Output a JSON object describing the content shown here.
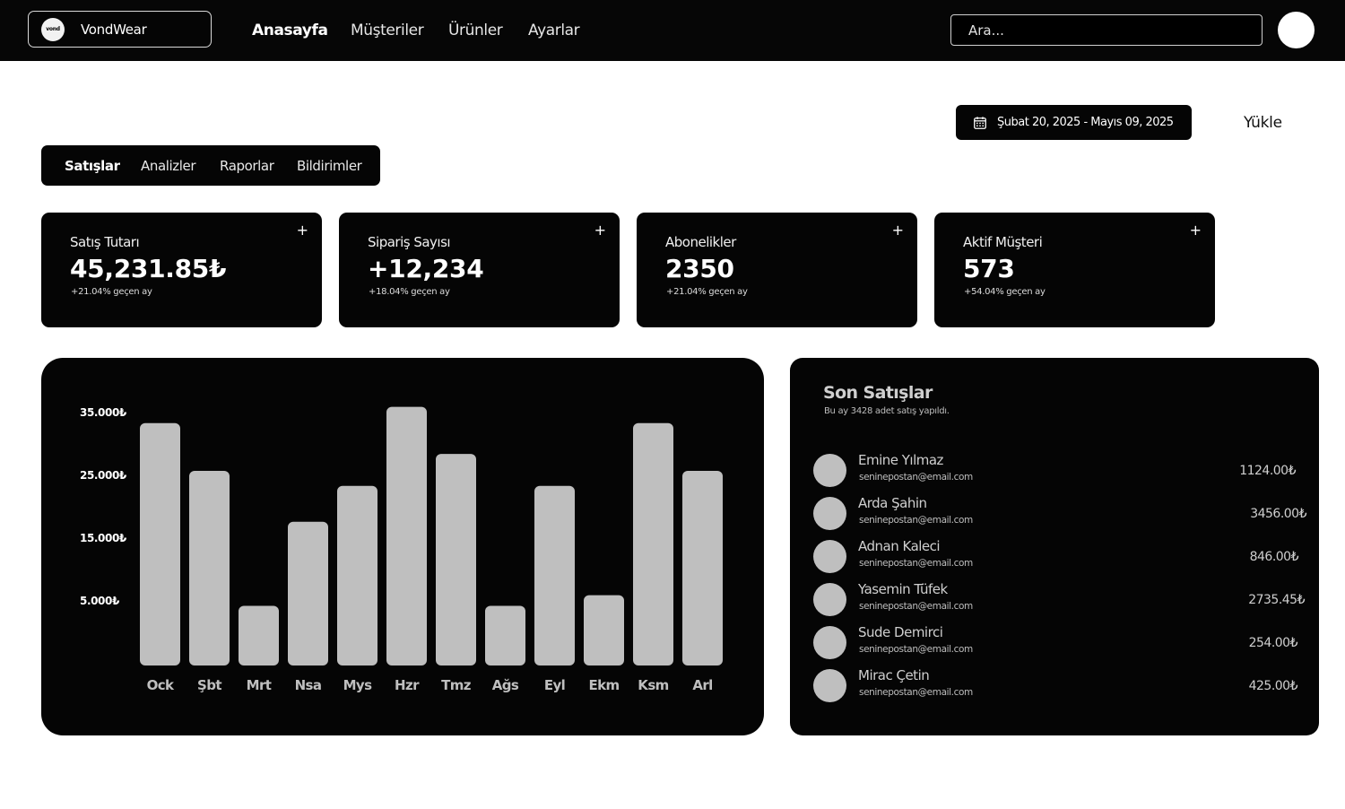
{
  "header": {
    "brand_logo_text": "vond",
    "brand_name": "VondWear",
    "nav": [
      {
        "label": "Anasayfa",
        "active": true
      },
      {
        "label": "Müşteriler",
        "active": false
      },
      {
        "label": "Ürünler",
        "active": false
      },
      {
        "label": "Ayarlar",
        "active": false
      }
    ],
    "search_placeholder": "Ara..."
  },
  "toolbar": {
    "date_range": "Şubat  20, 2025 - Mayıs 09, 2025",
    "download_label": "Yükle"
  },
  "tabs": [
    {
      "label": "Satışlar",
      "active": true
    },
    {
      "label": "Analizler",
      "active": false
    },
    {
      "label": "Raporlar",
      "active": false
    },
    {
      "label": "Bildirimler",
      "active": false
    }
  ],
  "stats": [
    {
      "title": "Satış Tutarı",
      "value": "45,231.85₺",
      "change": "+21.04% geçen ay",
      "action": "+"
    },
    {
      "title": "Sipariş Sayısı",
      "value": "+12,234",
      "change": "+18.04% geçen ay",
      "action": "+"
    },
    {
      "title": "Abonelikler",
      "value": "2350",
      "change": "+21.04% geçen ay",
      "action": "+"
    },
    {
      "title": "Aktif Müşteri",
      "value": "573",
      "change": "+54.04% geçen ay",
      "action": "+"
    }
  ],
  "chart_data": {
    "type": "bar",
    "categories": [
      "Ock",
      "Şbt",
      "Mrt",
      "Nsa",
      "Mys",
      "Hzr",
      "Tmz",
      "Ağs",
      "Eyl",
      "Ekm",
      "Ksm",
      "Arl"
    ],
    "values": [
      38600,
      31000,
      9500,
      22900,
      28600,
      41200,
      33700,
      9500,
      28600,
      11200,
      38600,
      31000
    ],
    "ytick_values": [
      5000,
      15000,
      25000,
      35000
    ],
    "ytick_labels": [
      "5.000₺",
      "15.000₺",
      "25.000₺",
      "35.000₺"
    ],
    "bar_color": "#bfbfbf",
    "background": "#050505",
    "grid": false
  },
  "recent_sales": {
    "title": "Son Satışlar",
    "subtitle": "Bu ay 3428 adet satış yapıldı.",
    "items": [
      {
        "name": "Emine Yılmaz",
        "email": "seninepostan@email.com",
        "amount": "1124.00₺"
      },
      {
        "name": "Arda Şahin",
        "email": "seninepostan@email.com",
        "amount": "3456.00₺"
      },
      {
        "name": "Adnan Kaleci",
        "email": "seninepostan@email.com",
        "amount": "846.00₺"
      },
      {
        "name": "Yasemin Tüfek",
        "email": "seninepostan@email.com",
        "amount": "2735.45₺"
      },
      {
        "name": "Sude Demirci",
        "email": "seninepostan@email.com",
        "amount": "254.00₺"
      },
      {
        "name": "Mirac Çetin",
        "email": "seninepostan@email.com",
        "amount": "425.00₺"
      }
    ]
  }
}
